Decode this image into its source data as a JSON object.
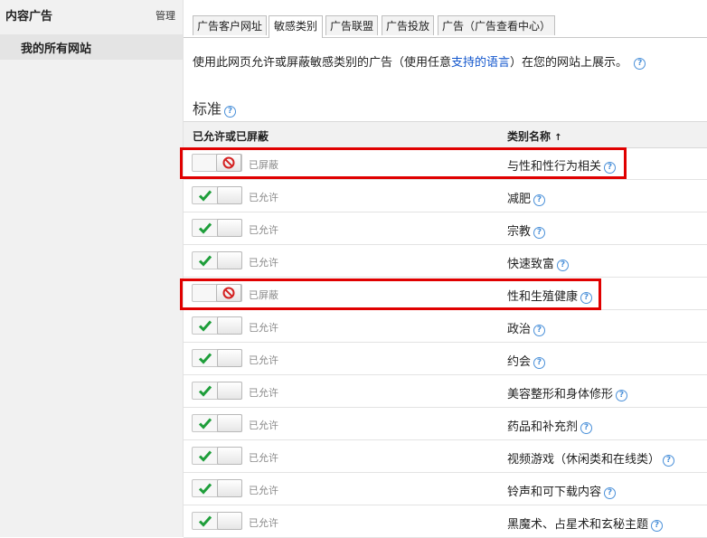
{
  "sidebar": {
    "title": "内容广告",
    "manage": "管理",
    "item": "我的所有网站"
  },
  "tabs": [
    {
      "label": "广告客户网址"
    },
    {
      "label": "敏感类别",
      "active": true
    },
    {
      "label": "广告联盟"
    },
    {
      "label": "广告投放"
    },
    {
      "label": "广告（广告查看中心）"
    }
  ],
  "description": {
    "before": "使用此网页允许或屏蔽敏感类别的广告（使用任意",
    "link": "支持的语言",
    "after": "）在您的网站上展示。"
  },
  "section_title": "标准",
  "help_glyph": "?",
  "table": {
    "col_status": "已允许或已屏蔽",
    "col_category": "类别名称",
    "sort_indicator": "↑",
    "rows": [
      {
        "state": "blocked",
        "status": "已屏蔽",
        "category": "与性和性行为相关"
      },
      {
        "state": "allowed",
        "status": "已允许",
        "category": "减肥"
      },
      {
        "state": "allowed",
        "status": "已允许",
        "category": "宗教"
      },
      {
        "state": "allowed",
        "status": "已允许",
        "category": "快速致富"
      },
      {
        "state": "blocked",
        "status": "已屏蔽",
        "category": "性和生殖健康"
      },
      {
        "state": "allowed",
        "status": "已允许",
        "category": "政治"
      },
      {
        "state": "allowed",
        "status": "已允许",
        "category": "约会"
      },
      {
        "state": "allowed",
        "status": "已允许",
        "category": "美容整形和身体修形"
      },
      {
        "state": "allowed",
        "status": "已允许",
        "category": "药品和补充剂"
      },
      {
        "state": "allowed",
        "status": "已允许",
        "category": "视频游戏（休闲类和在线类）"
      },
      {
        "state": "allowed",
        "status": "已允许",
        "category": "铃声和可下载内容"
      },
      {
        "state": "allowed",
        "status": "已允许",
        "category": "黑魔术、占星术和玄秘主题"
      }
    ]
  },
  "colors": {
    "check": "#1e9e3a",
    "ban": "#d42020",
    "highlight": "#e00000",
    "link": "#1155cc"
  }
}
